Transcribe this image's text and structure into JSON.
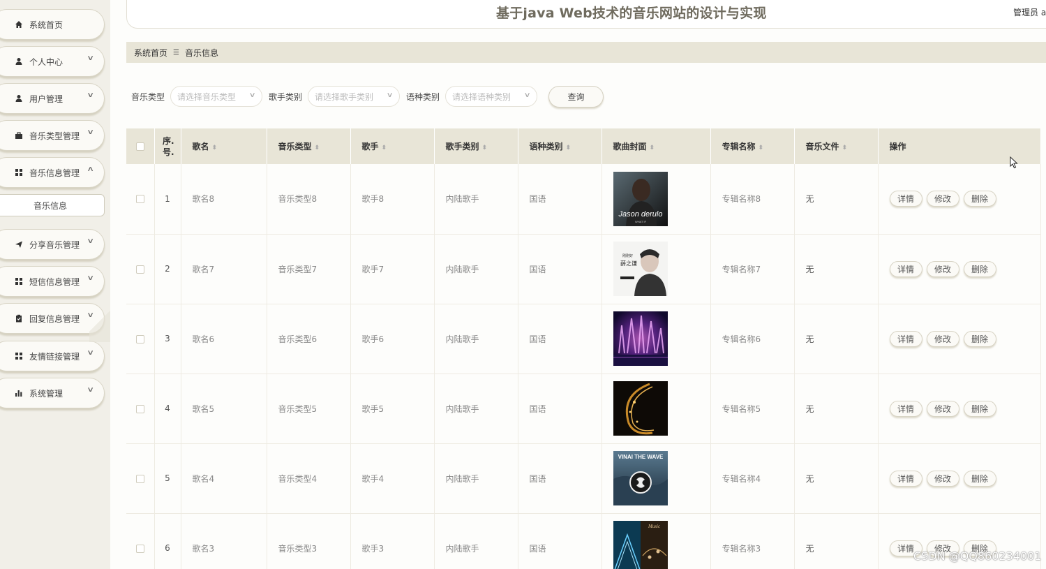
{
  "header": {
    "title": "基于java Web技术的音乐网站的设计与实现",
    "user": "管理员 a"
  },
  "sidebar": {
    "items": [
      {
        "label": "系统首页",
        "icon": "home-icon",
        "chevron": ""
      },
      {
        "label": "个人中心",
        "icon": "user-icon",
        "chevron": "∨"
      },
      {
        "label": "用户管理",
        "icon": "user-icon",
        "chevron": "∨"
      },
      {
        "label": "音乐类型管理",
        "icon": "briefcase-icon",
        "chevron": "∨"
      },
      {
        "label": "音乐信息管理",
        "icon": "grid-icon",
        "chevron": "∧"
      },
      {
        "label": "分享音乐管理",
        "icon": "send-icon",
        "chevron": "∨"
      },
      {
        "label": "短信信息管理",
        "icon": "grid-icon",
        "chevron": "∨"
      },
      {
        "label": "回复信息管理",
        "icon": "clipboard-icon",
        "chevron": "∨"
      },
      {
        "label": "友情链接管理",
        "icon": "grid-icon",
        "chevron": "∨"
      },
      {
        "label": "系统管理",
        "icon": "bar-chart-icon",
        "chevron": "∨"
      }
    ],
    "submenu": {
      "label": "音乐信息"
    }
  },
  "breadcrumb": {
    "home": "系统首页",
    "separator": "☰",
    "current": "音乐信息"
  },
  "filters": {
    "music_type": {
      "label": "音乐类型",
      "placeholder": "请选择音乐类型"
    },
    "singer_type": {
      "label": "歌手类别",
      "placeholder": "请选择歌手类别"
    },
    "language_type": {
      "label": "语种类别",
      "placeholder": "请选择语种类别"
    },
    "query_label": "查询"
  },
  "table": {
    "columns": [
      "序号",
      "歌名",
      "音乐类型",
      "歌手",
      "歌手类别",
      "语种类别",
      "歌曲封面",
      "专辑名称",
      "音乐文件",
      "操作"
    ],
    "index_header": "序.号.",
    "rows": [
      {
        "index": "1",
        "song": "歌名8",
        "music_type": "音乐类型8",
        "singer": "歌手8",
        "singer_type": "内陆歌手",
        "language": "国语",
        "album": "专辑名称8",
        "file": "无",
        "cover_text": "Jason derulo",
        "cover_sub": "WHAT IF"
      },
      {
        "index": "2",
        "song": "歌名7",
        "music_type": "音乐类型7",
        "singer": "歌手7",
        "singer_type": "内陆歌手",
        "language": "国语",
        "album": "专辑名称7",
        "file": "无",
        "cover_text": "薛之谦",
        "cover_sub": "刚刚好"
      },
      {
        "index": "3",
        "song": "歌名6",
        "music_type": "音乐类型6",
        "singer": "歌手6",
        "singer_type": "内陆歌手",
        "language": "国语",
        "album": "专辑名称6",
        "file": "无",
        "cover_text": "",
        "cover_sub": ""
      },
      {
        "index": "4",
        "song": "歌名5",
        "music_type": "音乐类型5",
        "singer": "歌手5",
        "singer_type": "内陆歌手",
        "language": "国语",
        "album": "专辑名称5",
        "file": "无",
        "cover_text": "",
        "cover_sub": ""
      },
      {
        "index": "5",
        "song": "歌名4",
        "music_type": "音乐类型4",
        "singer": "歌手4",
        "singer_type": "内陆歌手",
        "language": "国语",
        "album": "专辑名称4",
        "file": "无",
        "cover_text": "VINAI THE WAVE",
        "cover_sub": ""
      },
      {
        "index": "6",
        "song": "歌名3",
        "music_type": "音乐类型3",
        "singer": "歌手3",
        "singer_type": "内陆歌手",
        "language": "国语",
        "album": "专辑名称3",
        "file": "无",
        "cover_text": "Music",
        "cover_sub": ""
      }
    ],
    "actions": {
      "detail": "详情",
      "edit": "修改",
      "delete": "删除"
    }
  },
  "watermark": "CSDN @QQ860234001"
}
